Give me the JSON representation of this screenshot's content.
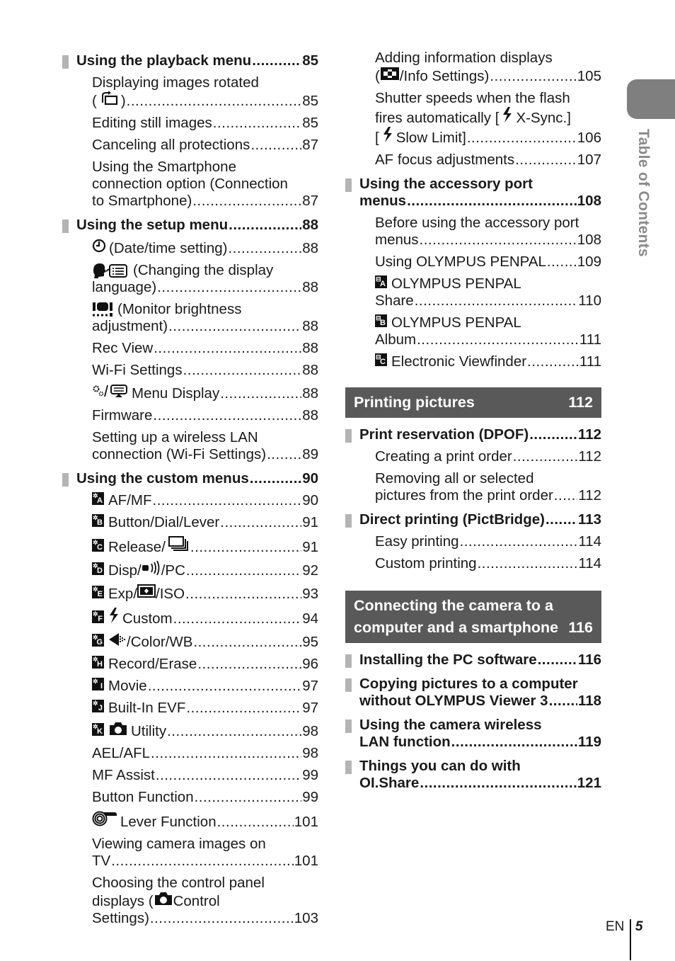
{
  "side_tab": {
    "label": "Table of Contents",
    "color": "#7f7f7f"
  },
  "colors": {
    "section_bar": "#595959",
    "section_mark": "#b4b4b4"
  },
  "left_column": {
    "playback": {
      "title": "Using the playback menu",
      "page": "85",
      "items": [
        {
          "pre": "Displaying images rotated",
          "text": "()",
          "icon": "rotate-icon",
          "page": "85"
        },
        {
          "text": "Editing still images",
          "page": "85"
        },
        {
          "text": "Canceling all protections",
          "page": "87"
        },
        {
          "pre": "Using the Smartphone",
          "pre2": "connection option (Connection",
          "text": "to Smartphone)",
          "page": "87"
        }
      ]
    },
    "setup": {
      "title": "Using the setup menu",
      "page": "88",
      "items": [
        {
          "text": "(Date/time setting)",
          "icon": "clock-icon",
          "page": "88"
        },
        {
          "pre": "(Changing the display",
          "icon": "language-icon",
          "text": "language)",
          "page": "88"
        },
        {
          "pre": "(Monitor brightness",
          "icon": "monitor-brightness-icon",
          "text": "adjustment)",
          "page": "88"
        },
        {
          "text": "Rec View",
          "page": "88"
        },
        {
          "text": "Wi-Fi Settings",
          "page": "88"
        },
        {
          "text": "Menu Display",
          "icon": "gear-slash-menu-icon",
          "page": "88"
        },
        {
          "text": "Firmware",
          "page": "88"
        },
        {
          "pre": "Setting up a wireless LAN",
          "text": "connection (Wi-Fi Settings)",
          "page": "89"
        }
      ]
    },
    "custom": {
      "title": "Using the custom menus",
      "page": "90",
      "items": [
        {
          "badge": "A",
          "text": "AF/MF",
          "page": "90"
        },
        {
          "badge": "B",
          "text": "Button/Dial/Lever",
          "page": "91"
        },
        {
          "badge": "C",
          "text": "Release/",
          "icon2": "sequential-icon",
          "page": "91"
        },
        {
          "badge": "D",
          "text": "Disp/",
          "icon2": "beep-icon",
          "text2": "/PC",
          "page": "92"
        },
        {
          "badge": "E",
          "text": "Exp/",
          "icon2": "metering-icon",
          "text2": "/ISO",
          "page": "93"
        },
        {
          "badge": "F",
          "icon2": "flash-icon",
          "text": "Custom",
          "page": "94"
        },
        {
          "badge": "G",
          "icon2": "quality-icon",
          "text": "/Color/WB",
          "page": "95"
        },
        {
          "badge": "H",
          "text": "Record/Erase",
          "page": "96"
        },
        {
          "badge": "I",
          "text": "Movie",
          "page": "97"
        },
        {
          "badge": "J",
          "text": "Built-In EVF",
          "page": "97"
        },
        {
          "badge": "K",
          "icon2": "camera-icon",
          "text": "Utility",
          "page": "98"
        },
        {
          "text": "AEL/AFL",
          "page": "98"
        },
        {
          "text": "MF Assist",
          "page": "99"
        },
        {
          "text": "Button Function",
          "page": "99"
        },
        {
          "icon": "lever-icon",
          "text": "Lever Function",
          "page": "101"
        },
        {
          "pre": "Viewing camera images on",
          "text": "TV",
          "page": "101"
        },
        {
          "pre": "Choosing the control panel",
          "pre2a": "displays (",
          "pre2b": "Control",
          "text": "Settings)",
          "page": "103"
        }
      ]
    }
  },
  "right_column": {
    "custom_cont": [
      {
        "pre": "Adding information displays",
        "text": "/Info Settings)",
        "icon": "info-display-icon",
        "page": "105"
      },
      {
        "pre": "Shutter speeds when the flash",
        "pre2a": "fires automatically [",
        "pre2b": "X-Sync.]",
        "text": "Slow Limit]",
        "page": "106"
      },
      {
        "text": "AF focus adjustments",
        "page": "107"
      }
    ],
    "accessory": {
      "title_line1": "Using the accessory port",
      "title_line2": "menus",
      "page": "108",
      "items": [
        {
          "pre": "Before using the accessory port",
          "text": "menus",
          "page": "108"
        },
        {
          "text": "Using OLYMPUS PENPAL",
          "page": "109"
        },
        {
          "badge": "A",
          "pre": "OLYMPUS PENPAL",
          "text": "Share",
          "page": "110"
        },
        {
          "badge": "B",
          "pre": "OLYMPUS PENPAL",
          "text": "Album",
          "page": "111"
        },
        {
          "badge": "C",
          "text": "Electronic Viewfinder",
          "page": "111"
        }
      ]
    },
    "printing_bar": {
      "title": "Printing pictures",
      "page": "112"
    },
    "dpof": {
      "title": "Print reservation (DPOF)",
      "page": "112",
      "items": [
        {
          "text": "Creating a print order",
          "page": "112"
        },
        {
          "pre": "Removing all or selected",
          "text": "pictures from the print order",
          "page": "112"
        }
      ]
    },
    "pictbridge": {
      "title": "Direct printing (PictBridge)",
      "page": "113",
      "items": [
        {
          "text": "Easy printing",
          "page": "114"
        },
        {
          "text": "Custom printing",
          "page": "114"
        }
      ]
    },
    "connect_bar": {
      "title": "Connecting the camera to a\ncomputer and a smartphone",
      "page": "116"
    },
    "connect_items": [
      {
        "text": "Installing the PC software",
        "page": "116"
      },
      {
        "pre": "Copying pictures to a computer",
        "text": "without OLYMPUS Viewer 3",
        "page": "118"
      },
      {
        "pre": "Using the camera wireless",
        "text": "LAN function",
        "page": "119"
      },
      {
        "pre": "Things you can do with",
        "text": "OI.Share",
        "page": "121"
      }
    ]
  },
  "footer": {
    "lang": "EN",
    "page": "5"
  }
}
